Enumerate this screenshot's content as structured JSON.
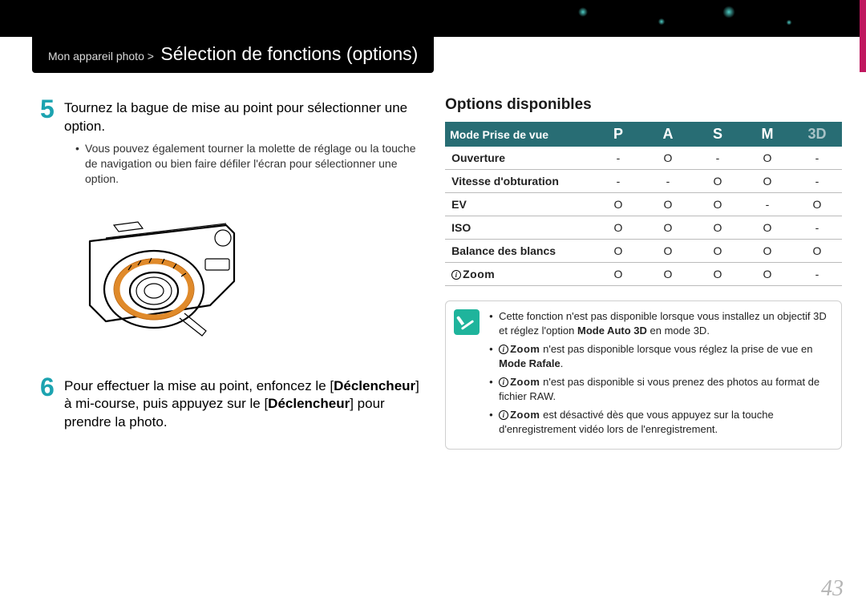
{
  "breadcrumb": {
    "parent": "Mon appareil photo >",
    "title": "Sélection de fonctions (options)"
  },
  "steps": {
    "s5": {
      "num": "5",
      "text": "Tournez la bague de mise au point pour sélectionner une option.",
      "bullet": "Vous pouvez également tourner la molette de réglage ou la touche de navigation ou bien faire défiler l'écran pour sélectionner une option."
    },
    "s6": {
      "num": "6",
      "text_parts": {
        "a": "Pour effectuer la mise au point, enfoncez le [",
        "b": "Déclencheur",
        "c": "] à mi-course, puis appuyez sur le [",
        "d": "Déclencheur",
        "e": "] pour prendre la photo."
      }
    }
  },
  "options": {
    "heading": "Options disponibles",
    "header": {
      "rowhead": "Mode Prise de vue",
      "P": "P",
      "A": "A",
      "S": "S",
      "M": "M",
      "D3": "3D"
    },
    "rows": [
      {
        "label": "Ouverture",
        "P": "-",
        "A": "O",
        "S": "-",
        "M": "O",
        "D3": "-"
      },
      {
        "label": "Vitesse d'obturation",
        "P": "-",
        "A": "-",
        "S": "O",
        "M": "O",
        "D3": "-"
      },
      {
        "label": "EV",
        "P": "O",
        "A": "O",
        "S": "O",
        "M": "-",
        "D3": "O"
      },
      {
        "label": "ISO",
        "P": "O",
        "A": "O",
        "S": "O",
        "M": "O",
        "D3": "-"
      },
      {
        "label": "Balance des blancs",
        "P": "O",
        "A": "O",
        "S": "O",
        "M": "O",
        "D3": "O"
      },
      {
        "label": "__izoom__",
        "P": "O",
        "A": "O",
        "S": "O",
        "M": "O",
        "D3": "-"
      }
    ],
    "izoom_label": "Zoom"
  },
  "notes": {
    "n1": {
      "a": "Cette fonction n'est pas disponible lorsque vous installez un objectif 3D et réglez l'option ",
      "b": "Mode Auto 3D",
      "c": " en mode 3D."
    },
    "n2": {
      "a": " n'est pas disponible lorsque vous réglez la prise de vue en ",
      "b": "Mode Rafale",
      "c": "."
    },
    "n3": " n'est pas disponible si vous prenez des photos au format de fichier RAW.",
    "n4": " est désactivé dès que vous appuyez sur la touche d'enregistrement vidéo lors de l'enregistrement."
  },
  "page_number": "43"
}
